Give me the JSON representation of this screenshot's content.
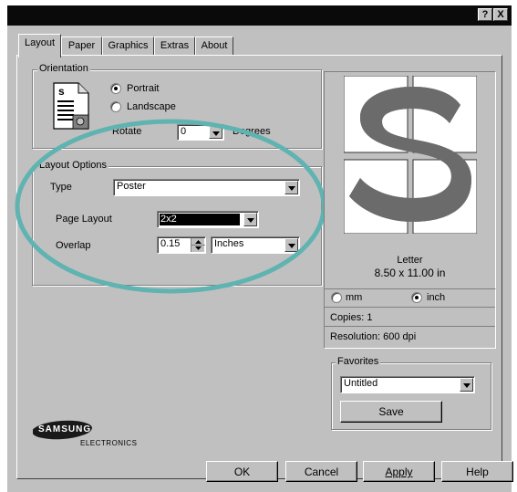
{
  "titlebar": {
    "help_label": "?",
    "close_label": "X"
  },
  "tabs": [
    {
      "label": "Layout",
      "active": true
    },
    {
      "label": "Paper"
    },
    {
      "label": "Graphics"
    },
    {
      "label": "Extras"
    },
    {
      "label": "About"
    }
  ],
  "orientation": {
    "group_label": "Orientation",
    "portrait_label": "Portrait",
    "landscape_label": "Landscape",
    "selected": "Portrait",
    "rotate_label": "Rotate",
    "rotate_value": "0",
    "degrees_label": "Degrees",
    "icon_letter": "s"
  },
  "layout_options": {
    "group_label": "Layout Options",
    "type_label": "Type",
    "type_value": "Poster",
    "page_layout_label": "Page Layout",
    "page_layout_value": "2x2",
    "overlap_label": "Overlap",
    "overlap_value": "0.15",
    "overlap_unit": "Inches"
  },
  "preview": {
    "paper_name": "Letter",
    "paper_size": "8.50 x 11.00 in",
    "mm_label": "mm",
    "inch_label": "inch",
    "unit_selected": "inch",
    "copies": "Copies: 1",
    "resolution": "Resolution: 600 dpi"
  },
  "favorites": {
    "group_label": "Favorites",
    "value": "Untitled",
    "save_label": "Save"
  },
  "logo": {
    "brand": "SAMSUNG",
    "sub": "ELECTRONICS"
  },
  "buttons": {
    "ok": "OK",
    "cancel": "Cancel",
    "apply": "Apply",
    "help": "Help"
  },
  "colors": {
    "annotation_ellipse": "#5fb3b0",
    "preview_shape": "#6b6b6b"
  }
}
